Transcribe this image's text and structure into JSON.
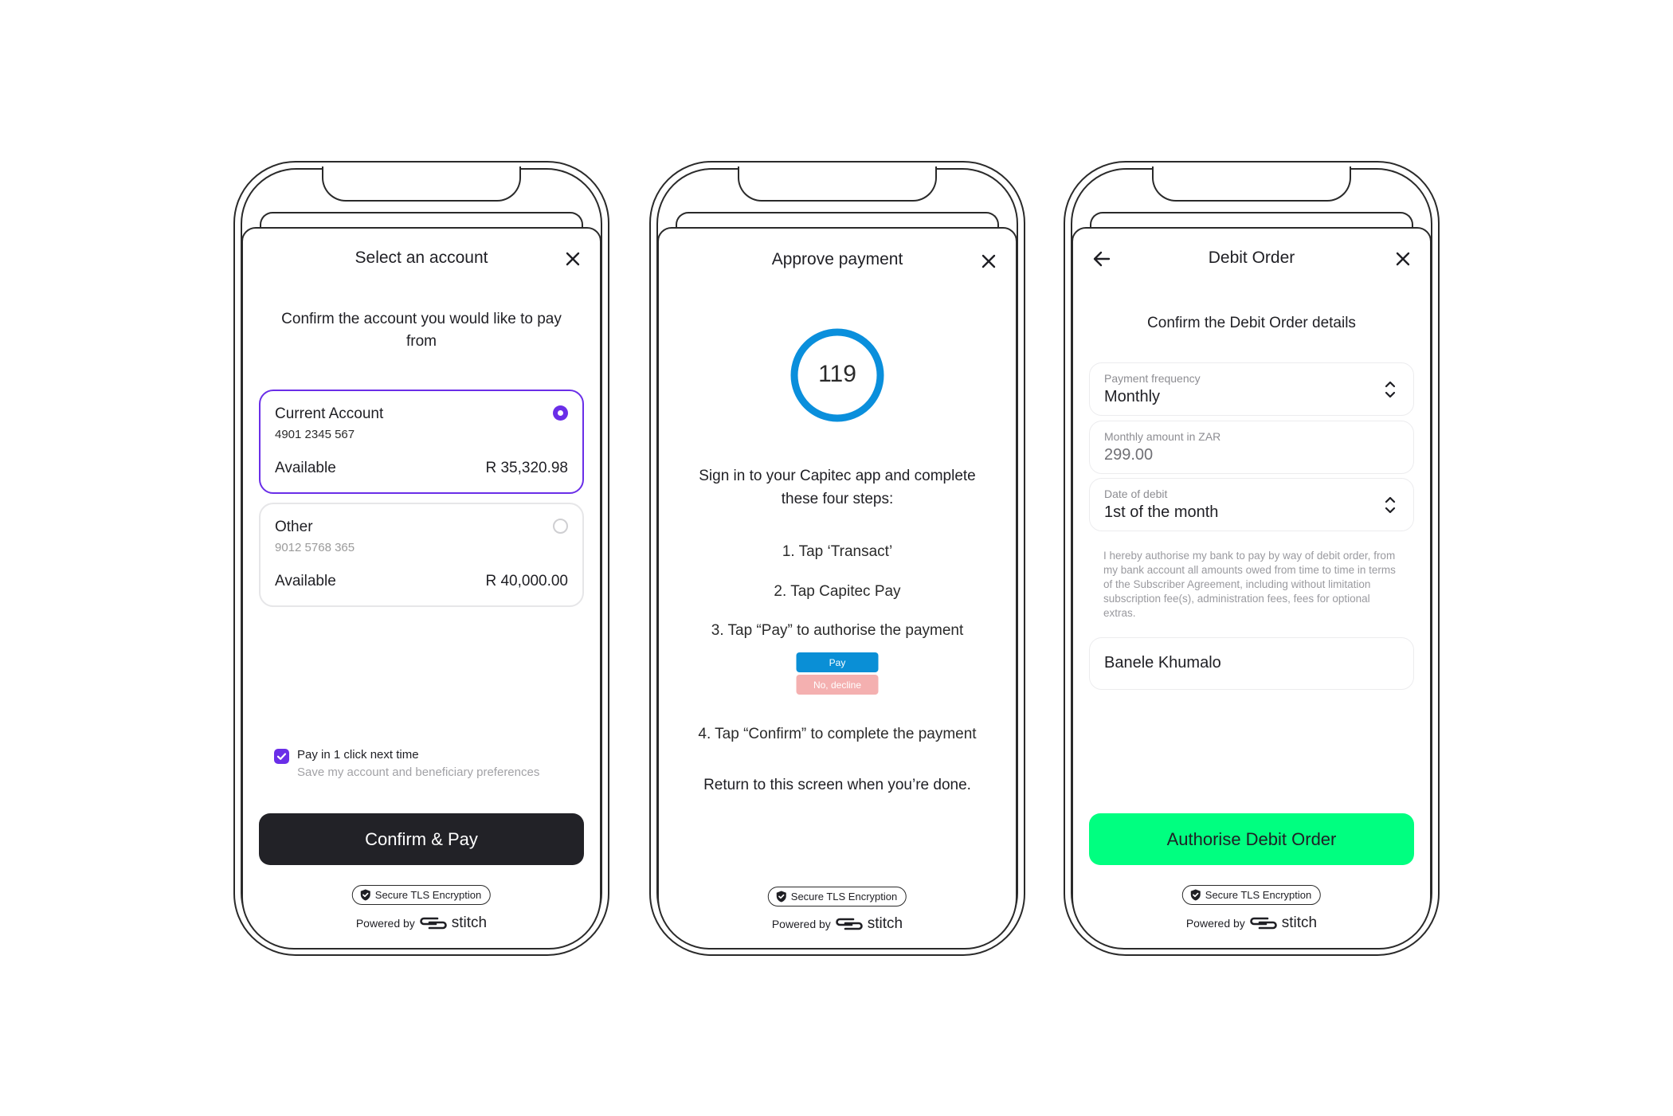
{
  "screens": [
    {
      "id": "select-account",
      "title": "Select an account",
      "close_icon": "close-icon",
      "prompt": "Confirm the account you would like to pay from",
      "accounts": [
        {
          "name": "Current Account",
          "number": "4901 2345 567",
          "available_label": "Available",
          "amount": "R 35,320.98",
          "selected": true
        },
        {
          "name": "Other",
          "number": "9012 5768 365",
          "available_label": "Available",
          "amount": "R 40,000.00",
          "selected": false
        }
      ],
      "one_click": {
        "checked": true,
        "label": "Pay in 1 click next time",
        "sublabel": "Save my account and beneficiary preferences"
      },
      "primary_button": "Confirm & Pay",
      "tls_badge": "Secure TLS Encryption",
      "powered_by": "Powered by",
      "brand": "stitch"
    },
    {
      "id": "approve-payment",
      "title": "Approve payment",
      "close_icon": "close-icon",
      "countdown": "119",
      "countdown_progress": 1.0,
      "instruction": "Sign in to your Capitec app and complete these four steps:",
      "steps": [
        "1. Tap ‘Transact’",
        "2. Tap Capitec Pay",
        "3. Tap “Pay” to authorise the payment",
        "4. Tap “Confirm” to complete the payment"
      ],
      "illustration": {
        "pay_label": "Pay",
        "decline_label": "No, decline"
      },
      "return_note": "Return to this screen when you’re done.",
      "tls_badge": "Secure TLS Encryption",
      "powered_by": "Powered by",
      "brand": "stitch"
    },
    {
      "id": "debit-order",
      "title": "Debit Order",
      "back_icon": "arrow-left-icon",
      "close_icon": "close-icon",
      "subtitle": "Confirm the Debit Order details",
      "fields": [
        {
          "label": "Payment frequency",
          "value": "Monthly",
          "type": "select"
        },
        {
          "label": "Monthly amount in ZAR",
          "value": "299.00",
          "type": "input"
        },
        {
          "label": "Date of debit",
          "value": "1st of the month",
          "type": "select"
        }
      ],
      "legal_text": "I hereby authorise my bank to pay by way of debit order, from my bank account all amounts owed from time to time in terms of the Subscriber Agreement, including without limitation subscription fee(s), administration fees, fees for optional extras.",
      "name_field": "Banele Khumalo",
      "primary_button": "Authorise Debit Order",
      "tls_badge": "Secure TLS Encryption",
      "powered_by": "Powered by",
      "brand": "stitch"
    }
  ],
  "colors": {
    "accent_purple": "#6a2ee8",
    "dark_button": "#222227",
    "green_button": "#00ff80",
    "countdown_ring": "#0a8fdc",
    "capitec_pay": "#0a8fd6",
    "capitec_decline": "#f4b0b0"
  }
}
